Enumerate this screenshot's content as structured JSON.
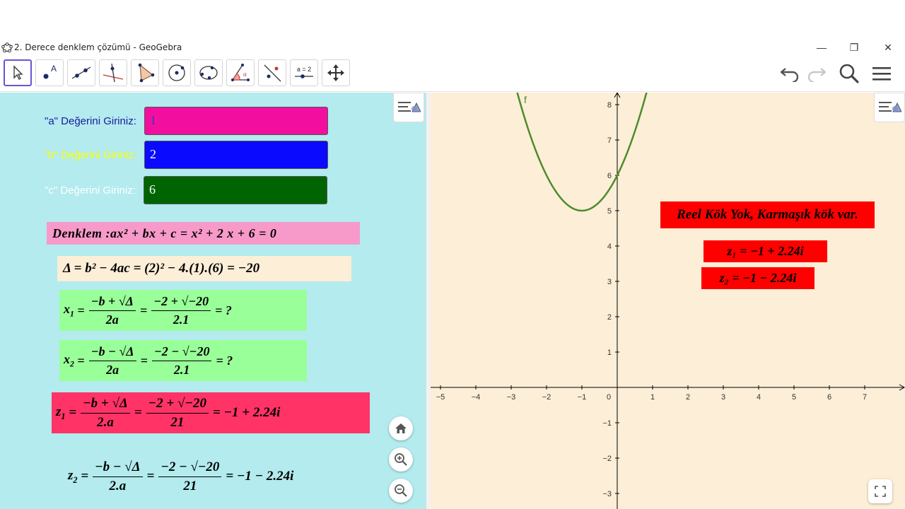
{
  "window": {
    "title": "2. Derece denklem çözümü - GeoGebra",
    "minimize_glyph": "—",
    "restore_glyph": "❐",
    "close_glyph": "✕"
  },
  "toolbar": {
    "tools": [
      {
        "name": "move-tool",
        "icon": "arrow-pointer-icon",
        "active": true
      },
      {
        "name": "point-tool",
        "icon": "point-icon",
        "label": "A"
      },
      {
        "name": "line-tool",
        "icon": "line-icon"
      },
      {
        "name": "perpendicular-tool",
        "icon": "perpendicular-line-icon"
      },
      {
        "name": "polygon-tool",
        "icon": "polygon-icon"
      },
      {
        "name": "circle-tool",
        "icon": "circle-icon"
      },
      {
        "name": "conic-tool",
        "icon": "conic-icon"
      },
      {
        "name": "angle-tool",
        "icon": "angle-icon",
        "label": "α"
      },
      {
        "name": "reflect-tool",
        "icon": "reflect-icon"
      },
      {
        "name": "slider-tool",
        "icon": "slider-icon",
        "label": "a = 2"
      },
      {
        "name": "move-graphics-tool",
        "icon": "move-graphics-icon"
      }
    ],
    "right": [
      "undo-icon",
      "redo-icon",
      "search-icon",
      "menu-icon"
    ]
  },
  "algebra": {
    "input_a": {
      "label": "\"a\" Değerini Giriniz:",
      "value": "1",
      "label_color": "#1a1aa0",
      "box_color": "#f20fa0",
      "text_color": "#3a3ab0"
    },
    "input_b": {
      "label": "\"b\" Değerini Giriniz:",
      "value": "2",
      "label_color": "#ffff00",
      "box_color": "#0a0aff",
      "text_color": "#ffffff"
    },
    "input_c": {
      "label": "\"c\" Değerini Giriniz:",
      "value": "6",
      "label_color": "#ffffff",
      "box_color": "#006400",
      "text_color": "#ffffff"
    },
    "equation": {
      "prefix": "Denklem : ",
      "lhs": "ax² + bx + c",
      "rhs": "x² + 2 x + 6 = 0",
      "bg": "#f79ac9"
    },
    "delta": {
      "text": "Δ = b² − 4ac = (2)² − 4.(1).(6) = −20",
      "bg": "#fdeed7"
    },
    "x1": {
      "lhs": "x",
      "sub": "1",
      "num1": "−b + √Δ",
      "den1": "2a",
      "num2": "−2 + √−20",
      "den2": "2.1",
      "result": "= ?",
      "bg": "#99ff99"
    },
    "x2": {
      "lhs": "x",
      "sub": "2",
      "num1": "−b − √Δ",
      "den1": "2a",
      "num2": "−2 − √−20",
      "den2": "2.1",
      "result": "= ?",
      "bg": "#99ff99"
    },
    "z1": {
      "lhs": "z",
      "sub": "1",
      "num1": "−b + √Δ",
      "den1": "2.a",
      "num2": "−2 + √−20",
      "den2": "21",
      "result": "= −1 + 2.24i",
      "bg": "#ff3366"
    },
    "z2": {
      "lhs": "z",
      "sub": "2",
      "num1": "−b − √Δ",
      "den1": "2.a",
      "num2": "−2 − √−20",
      "den2": "21",
      "result": "= −1 − 2.24i"
    }
  },
  "graphics": {
    "function_label": "f",
    "function": "x² + 2x + 6",
    "curve_color": "#4e8b2d",
    "x_ticks": [
      "−5",
      "−4",
      "−3",
      "−2",
      "−1",
      "0",
      "1",
      "2",
      "3",
      "4",
      "5",
      "6",
      "7"
    ],
    "y_ticks": [
      "8",
      "7",
      "6",
      "5",
      "4",
      "3",
      "2",
      "1",
      "−1",
      "−2",
      "−3"
    ],
    "message": {
      "text": "Reel Kök Yok, Karmaşık kök var.",
      "bg": "#ff0000"
    },
    "root1": {
      "text": "z₁ = −1 + 2.24i",
      "bg": "#ff0000"
    },
    "root2": {
      "text": "z₂ = −1 − 2.24i",
      "bg": "#ff0000"
    }
  }
}
